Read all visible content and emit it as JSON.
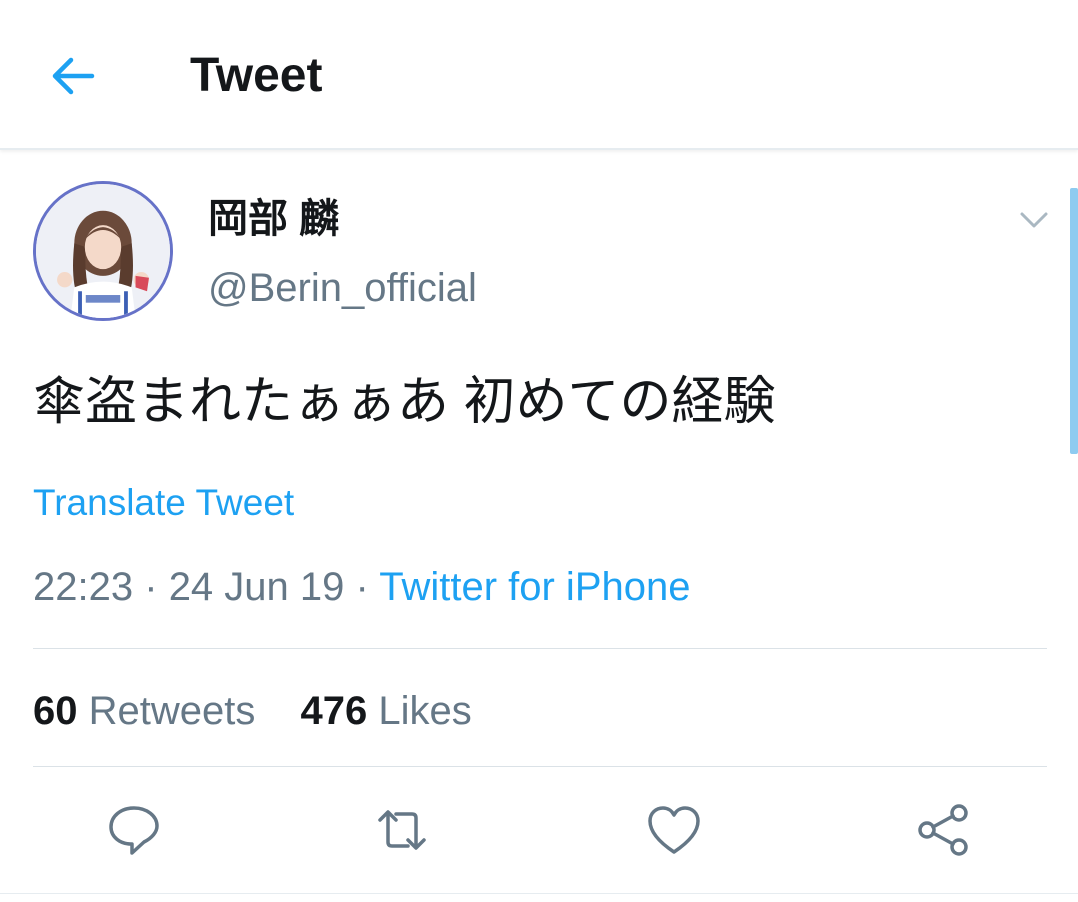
{
  "header": {
    "title": "Tweet",
    "back_icon": "arrow-left-icon"
  },
  "author": {
    "name": "岡部 麟",
    "handle": "@Berin_official"
  },
  "tweet": {
    "text": "傘盗まれたぁぁあ 初めての経験",
    "translate_label": "Translate Tweet",
    "time": "22:23",
    "separator": "·",
    "date": "24 Jun 19",
    "source": "Twitter for iPhone"
  },
  "stats": {
    "retweets_count": "60",
    "retweets_label": "Retweets",
    "likes_count": "476",
    "likes_label": "Likes"
  },
  "actions": [
    "reply-icon",
    "retweet-icon",
    "like-icon",
    "share-icon"
  ],
  "colors": {
    "accent": "#1da1f2",
    "text_primary": "#14171a",
    "text_secondary": "#657786",
    "avatar_ring": "#6672c8"
  }
}
